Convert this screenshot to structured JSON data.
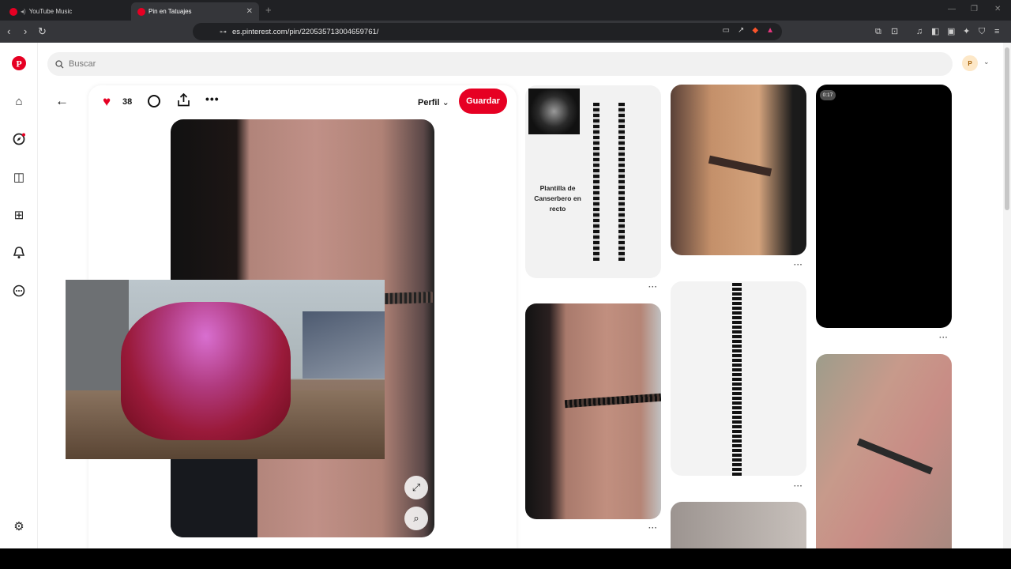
{
  "browser": {
    "tabs": [
      {
        "label": "YouTube Music"
      },
      {
        "label": "Pin en Tatuajes"
      }
    ],
    "url": "es.pinterest.com/pin/220535713004659761/"
  },
  "search": {
    "placeholder": "Buscar"
  },
  "avatar": {
    "initial": "P"
  },
  "pin": {
    "likes": "38",
    "profile_label": "Perfil",
    "save_label": "Guardar"
  },
  "grid": {
    "template_text": "Plantilla de Canserbero en recto",
    "video_duration": "0:17",
    "more": "···"
  },
  "colors": {
    "brand": "#e60023"
  }
}
